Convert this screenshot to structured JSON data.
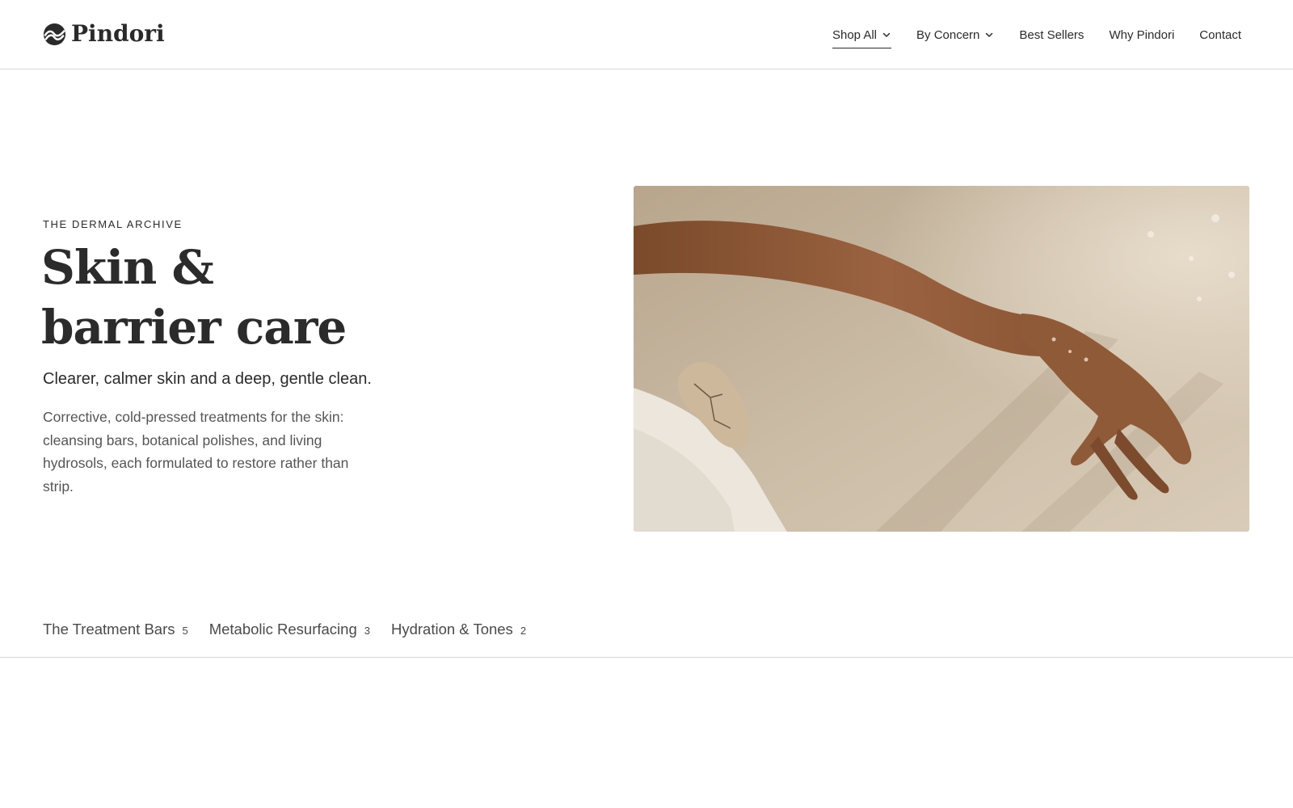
{
  "brand": {
    "name": "Pindori",
    "logo_icon": "pindori-logo-icon"
  },
  "nav": {
    "items": [
      {
        "label": "Shop All",
        "has_dropdown": true,
        "active": true
      },
      {
        "label": "By Concern",
        "has_dropdown": true,
        "active": false
      },
      {
        "label": "Best Sellers",
        "has_dropdown": false,
        "active": false
      },
      {
        "label": "Why Pindori",
        "has_dropdown": false,
        "active": false
      },
      {
        "label": "Contact",
        "has_dropdown": false,
        "active": false
      }
    ]
  },
  "hero": {
    "eyebrow": "THE DERMAL ARCHIVE",
    "title_line1": "Skin &",
    "title_line2": "barrier care",
    "subtitle": "Clearer, calmer skin and a deep, gentle clean.",
    "description": "Corrective, cold-pressed treatments for the skin: cleansing bars, botanical polishes, and living hydrosols, each formulated to restore rather than strip."
  },
  "tabs": [
    {
      "label": "The Treatment Bars",
      "count": "5"
    },
    {
      "label": "Metabolic Resurfacing",
      "count": "3"
    },
    {
      "label": "Hydration & Tones",
      "count": "2"
    }
  ],
  "colors": {
    "text": "#2b2b2b",
    "muted": "#555555",
    "divider": "#d6d6d6",
    "background": "#ffffff"
  }
}
